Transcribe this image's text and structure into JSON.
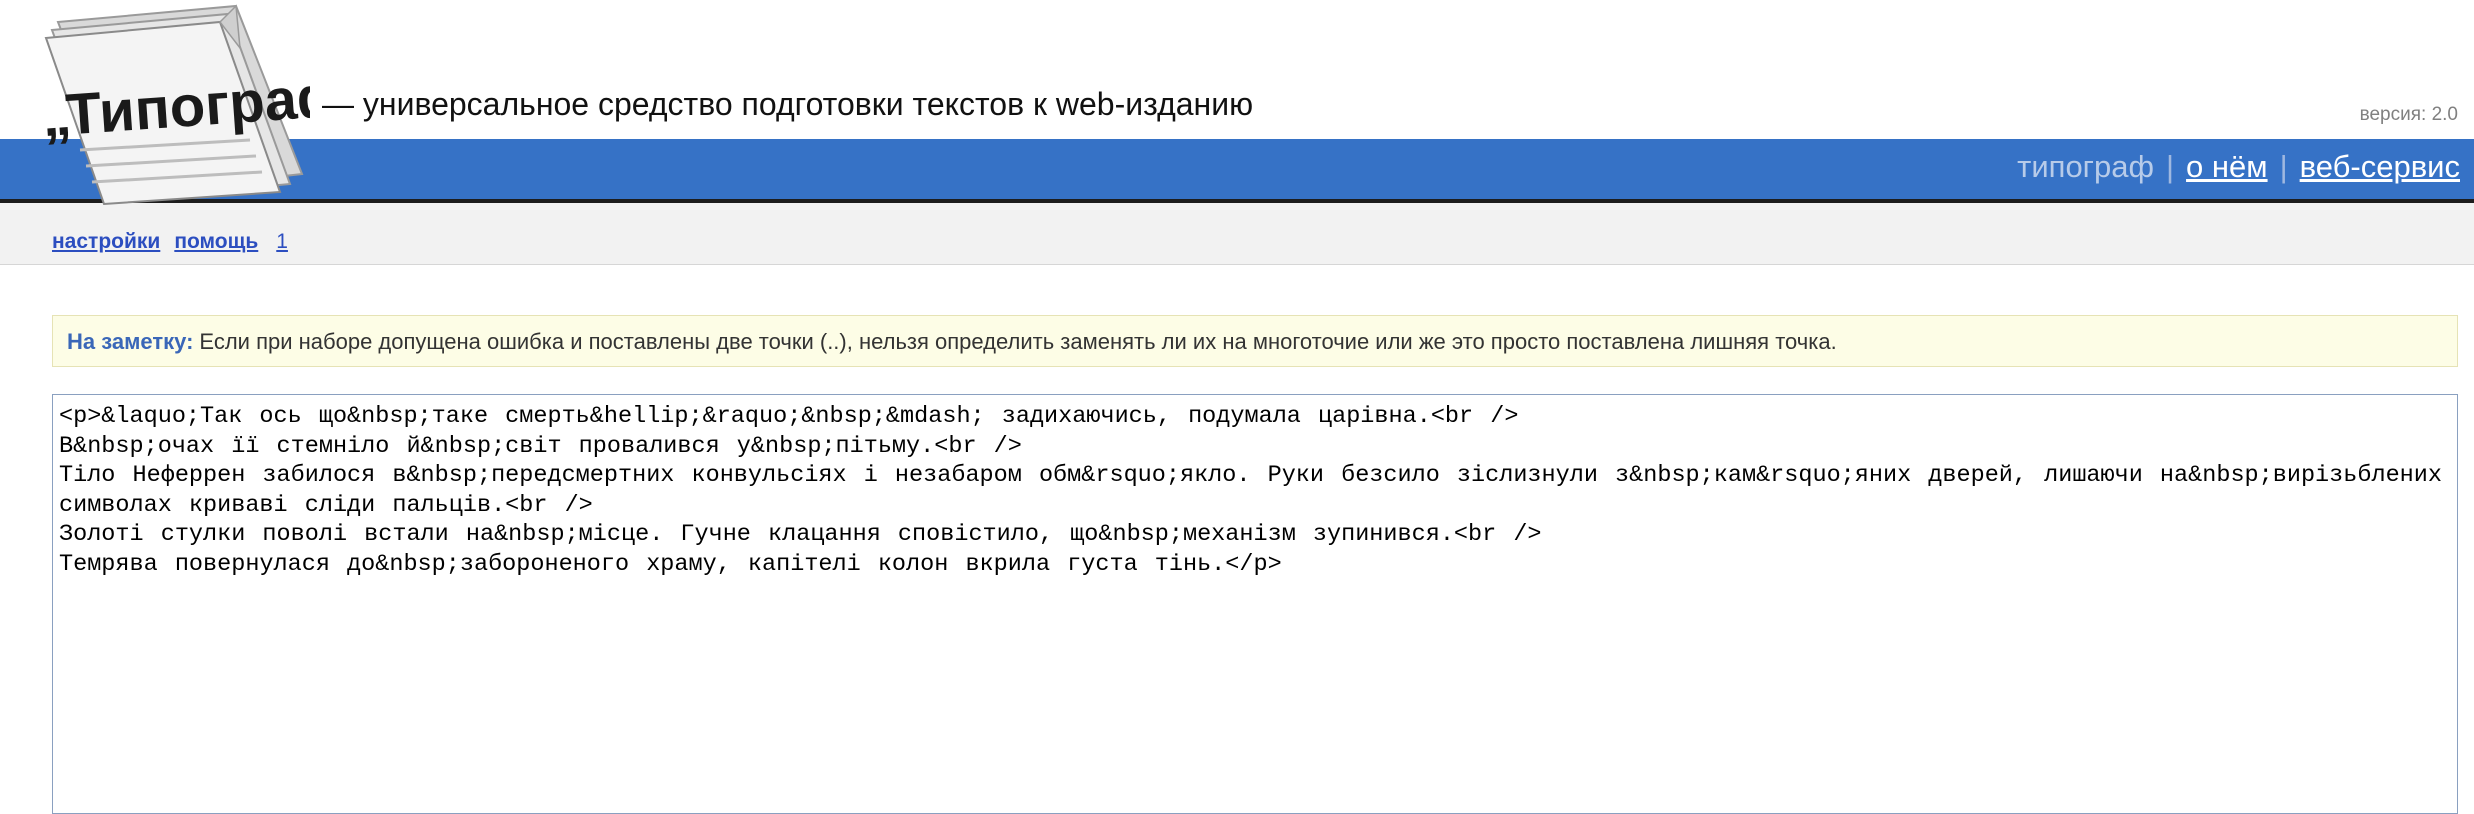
{
  "header": {
    "logo_text": "„Типограф“",
    "tagline": "— универсальное средство подготовки текстов к web-изданию",
    "version": "версия: 2.0"
  },
  "nav": {
    "current": "типограф",
    "separator": "|",
    "about": "о нём",
    "webservice": "веб-сервис"
  },
  "toolbar": {
    "settings": "настройки",
    "help": "помощь",
    "page": "1"
  },
  "note": {
    "label": "На заметку:",
    "text": "Если при наборе допущена ошибка и поставлены две точки (..), нельзя определить заменять ли их на многоточие или же это просто поставлена лишняя точка."
  },
  "editor": {
    "value": "<p>&laquo;Так ось що&nbsp;таке смерть&hellip;&raquo;&nbsp;&mdash; задихаючись, подумала царівна.<br />\nВ&nbsp;очах її стемніло й&nbsp;світ провалився у&nbsp;пітьму.<br />\nТіло Неферрен забилося в&nbsp;передсмертних конвульсіях і незабаром обм&rsquo;якло. Руки безсило зіслизнули з&nbsp;кам&rsquo;яних дверей, лишаючи на&nbsp;вирізьблених символах криваві сліди пальців.<br />\nЗолоті стулки поволі встали на&nbsp;місце. Гучне клацання сповістило, що&nbsp;механізм зупинився.<br />\nТемрява повернулася до&nbsp;забороненого храму, капітелі колон вкрила густа тінь.</p>"
  },
  "colors": {
    "accent_bar": "#3672c6",
    "link": "#2c4ec0",
    "note_label": "#3a67b8",
    "note_bg": "#fdfde6"
  }
}
